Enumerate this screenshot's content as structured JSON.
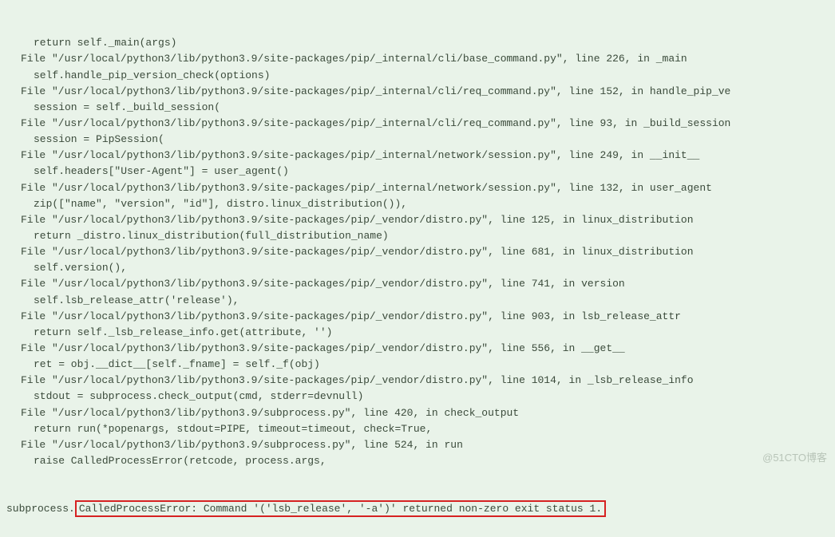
{
  "traceback": [
    {
      "indent": "indent2",
      "text": "return self._main(args)"
    },
    {
      "indent": "indent1",
      "text": "File \"/usr/local/python3/lib/python3.9/site-packages/pip/_internal/cli/base_command.py\", line 226, in _main"
    },
    {
      "indent": "indent2",
      "text": "self.handle_pip_version_check(options)"
    },
    {
      "indent": "indent1",
      "text": "File \"/usr/local/python3/lib/python3.9/site-packages/pip/_internal/cli/req_command.py\", line 152, in handle_pip_ve"
    },
    {
      "indent": "indent2",
      "text": "session = self._build_session("
    },
    {
      "indent": "indent1",
      "text": "File \"/usr/local/python3/lib/python3.9/site-packages/pip/_internal/cli/req_command.py\", line 93, in _build_session"
    },
    {
      "indent": "indent2",
      "text": "session = PipSession("
    },
    {
      "indent": "indent1",
      "text": "File \"/usr/local/python3/lib/python3.9/site-packages/pip/_internal/network/session.py\", line 249, in __init__"
    },
    {
      "indent": "indent2",
      "text": "self.headers[\"User-Agent\"] = user_agent()"
    },
    {
      "indent": "indent1",
      "text": "File \"/usr/local/python3/lib/python3.9/site-packages/pip/_internal/network/session.py\", line 132, in user_agent"
    },
    {
      "indent": "indent2",
      "text": "zip([\"name\", \"version\", \"id\"], distro.linux_distribution()),"
    },
    {
      "indent": "indent1",
      "text": "File \"/usr/local/python3/lib/python3.9/site-packages/pip/_vendor/distro.py\", line 125, in linux_distribution"
    },
    {
      "indent": "indent2",
      "text": "return _distro.linux_distribution(full_distribution_name)"
    },
    {
      "indent": "indent1",
      "text": "File \"/usr/local/python3/lib/python3.9/site-packages/pip/_vendor/distro.py\", line 681, in linux_distribution"
    },
    {
      "indent": "indent2",
      "text": "self.version(),"
    },
    {
      "indent": "indent1",
      "text": "File \"/usr/local/python3/lib/python3.9/site-packages/pip/_vendor/distro.py\", line 741, in version"
    },
    {
      "indent": "indent2",
      "text": "self.lsb_release_attr('release'),"
    },
    {
      "indent": "indent1",
      "text": "File \"/usr/local/python3/lib/python3.9/site-packages/pip/_vendor/distro.py\", line 903, in lsb_release_attr"
    },
    {
      "indent": "indent2",
      "text": "return self._lsb_release_info.get(attribute, '')"
    },
    {
      "indent": "indent1",
      "text": "File \"/usr/local/python3/lib/python3.9/site-packages/pip/_vendor/distro.py\", line 556, in __get__"
    },
    {
      "indent": "indent2",
      "text": "ret = obj.__dict__[self._fname] = self._f(obj)"
    },
    {
      "indent": "indent1",
      "text": "File \"/usr/local/python3/lib/python3.9/site-packages/pip/_vendor/distro.py\", line 1014, in _lsb_release_info"
    },
    {
      "indent": "indent2",
      "text": "stdout = subprocess.check_output(cmd, stderr=devnull)"
    },
    {
      "indent": "indent1",
      "text": "File \"/usr/local/python3/lib/python3.9/subprocess.py\", line 420, in check_output"
    },
    {
      "indent": "indent2",
      "text": "return run(*popenargs, stdout=PIPE, timeout=timeout, check=True,"
    },
    {
      "indent": "indent1",
      "text": "File \"/usr/local/python3/lib/python3.9/subprocess.py\", line 524, in run"
    },
    {
      "indent": "indent2",
      "text": "raise CalledProcessError(retcode, process.args,"
    }
  ],
  "error_line": {
    "prefix": "subprocess.",
    "highlighted": "CalledProcessError: Command '('lsb_release', '-a')' returned non-zero exit status 1."
  },
  "watermark": "@51CTO博客"
}
